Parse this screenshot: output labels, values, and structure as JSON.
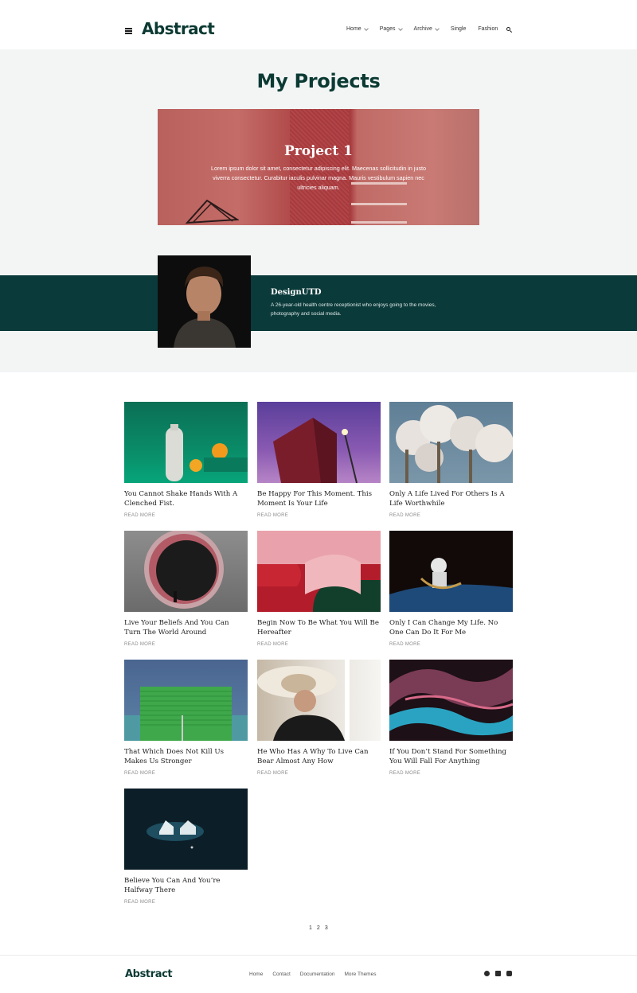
{
  "header": {
    "logo": "Abstract",
    "nav": [
      {
        "label": "Home",
        "dropdown": true
      },
      {
        "label": "Pages",
        "dropdown": true
      },
      {
        "label": "Archive",
        "dropdown": true
      },
      {
        "label": "Single",
        "dropdown": false
      },
      {
        "label": "Fashion",
        "dropdown": false
      }
    ]
  },
  "hero": {
    "title": "My Projects",
    "project": {
      "title": "Project 1",
      "description": "Lorem ipsum dolor sit amet, consectetur adipiscing elit. Maecenas sollicitudin in justo viverra consectetur. Curabitur iaculis pulvinar magna. Mauris vestibulum sapien nec ultricies aliquam."
    },
    "author": {
      "name": "DesignUTD",
      "bio": "A 26-year-old health centre receptionist who enjoys going to the movies, photography and social media."
    }
  },
  "posts": [
    {
      "title": "You Cannot Shake Hands With A Clenched Fist.",
      "read_more": "READ MORE"
    },
    {
      "title": "Be Happy For This Moment. This Moment Is Your Life",
      "read_more": "READ MORE"
    },
    {
      "title": "Only A Life Lived For Others Is A Life Worthwhile",
      "read_more": "READ MORE"
    },
    {
      "title": "Live Your Beliefs And You Can Turn The World Around",
      "read_more": "READ MORE"
    },
    {
      "title": "Begin Now To Be What You Will Be Hereafter",
      "read_more": "READ MORE"
    },
    {
      "title": "Only I Can Change My Life. No One Can Do It For Me",
      "read_more": "READ MORE"
    },
    {
      "title": "That Which Does Not Kill Us Makes Us Stronger",
      "read_more": "READ MORE"
    },
    {
      "title": "He Who Has A Why To Live Can Bear Almost Any How",
      "read_more": "READ MORE"
    },
    {
      "title": "If You Don’t Stand For Something You Will Fall For Anything",
      "read_more": "READ MORE"
    },
    {
      "title": "Believe You Can And You’re Halfway There",
      "read_more": "READ MORE"
    }
  ],
  "pagination": [
    "1",
    "2",
    "3"
  ],
  "footer": {
    "logo": "Abstract",
    "nav": [
      "Home",
      "Contact",
      "Documentation",
      "More Themes"
    ],
    "social_icons": [
      "facebook-icon",
      "twitter-icon",
      "youtube-icon"
    ]
  }
}
